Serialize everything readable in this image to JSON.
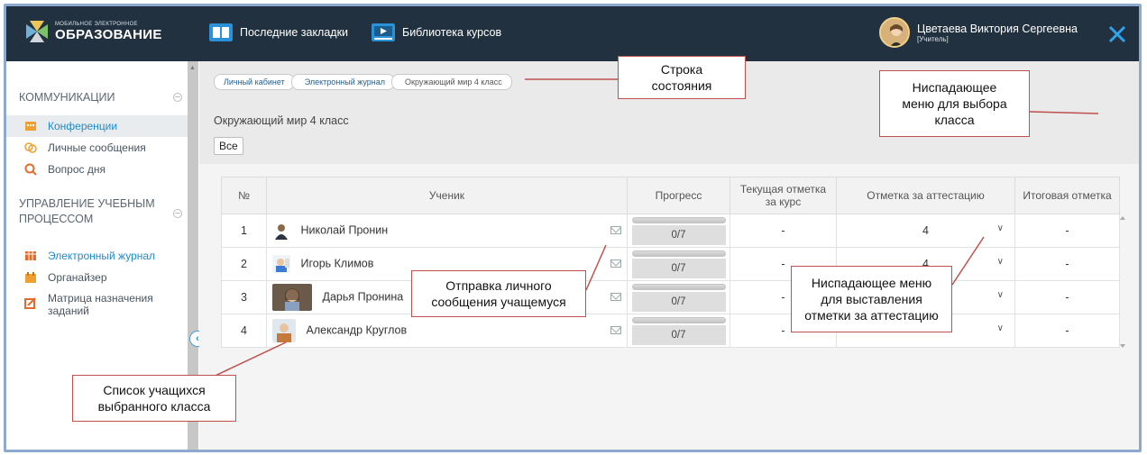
{
  "header": {
    "logo_small": "МОБИЛЬНОЕ ЭЛЕКТРОННОЕ",
    "logo_big": "ОБРАЗОВАНИЕ",
    "nav_bookmarks": "Последние закладки",
    "nav_library": "Библиотека курсов",
    "user_name": "Цветаева Виктория Сергеевна",
    "user_role": "[Учитель]",
    "bg_color": "#22313f"
  },
  "sidebar": {
    "section1": "КОММУНИКАЦИИ",
    "items1": [
      {
        "label": "Конференции",
        "icon": "conference-icon"
      },
      {
        "label": "Личные сообщения",
        "icon": "messages-icon"
      },
      {
        "label": "Вопрос дня",
        "icon": "question-icon"
      }
    ],
    "section2_line1": "УПРАВЛЕНИЕ УЧЕБНЫМ",
    "section2_line2": "ПРОЦЕССОМ",
    "items2": [
      {
        "label": "Электронный журнал",
        "icon": "journal-icon"
      },
      {
        "label": "Органайзер",
        "icon": "organizer-icon"
      },
      {
        "label_line1": "Матрица назначения",
        "label_line2": "заданий",
        "icon": "matrix-icon"
      }
    ],
    "accent_color": "#1f8ac9"
  },
  "breadcrumb": [
    "Личный кабинет",
    "Электронный журнал",
    "Окружающий мир 4 класс"
  ],
  "page_title": "Окружающий мир 4 класс",
  "filter_all": "Все",
  "table": {
    "headers": {
      "num": "№",
      "student": "Ученик",
      "progress": "Прогресс",
      "current_line1": "Текущая отметка",
      "current_line2": "за курс",
      "attestation": "Отметка за аттестацию",
      "final": "Итоговая отметка"
    },
    "rows": [
      {
        "num": "1",
        "name": "Николай Пронин",
        "progress": "0/7",
        "current": "-",
        "attestation": "4",
        "final": "-"
      },
      {
        "num": "2",
        "name": "Игорь Климов",
        "progress": "0/7",
        "current": "-",
        "attestation": "4",
        "final": "-"
      },
      {
        "num": "3",
        "name": "Дарья Пронина",
        "progress": "0/7",
        "current": "-",
        "attestation": "",
        "final": "-"
      },
      {
        "num": "4",
        "name": "Александр Круглов",
        "progress": "0/7",
        "current": "-",
        "attestation": "",
        "final": "-"
      }
    ]
  },
  "callouts": {
    "status_line1": "Строка",
    "status_line2": "состояния",
    "class_menu_line1": "Ниспадающее",
    "class_menu_line2": "меню для выбора",
    "class_menu_line3": "класса",
    "message_line1": "Отправка личного",
    "message_line2": "сообщения учащемуся",
    "grade_menu_line1": "Ниспадающее меню",
    "grade_menu_line2": "для выставления",
    "grade_menu_line3": "отметки за аттестацию",
    "students_line1": "Список учащихся",
    "students_line2": "выбранного класса",
    "border_color": "#c0504d"
  }
}
